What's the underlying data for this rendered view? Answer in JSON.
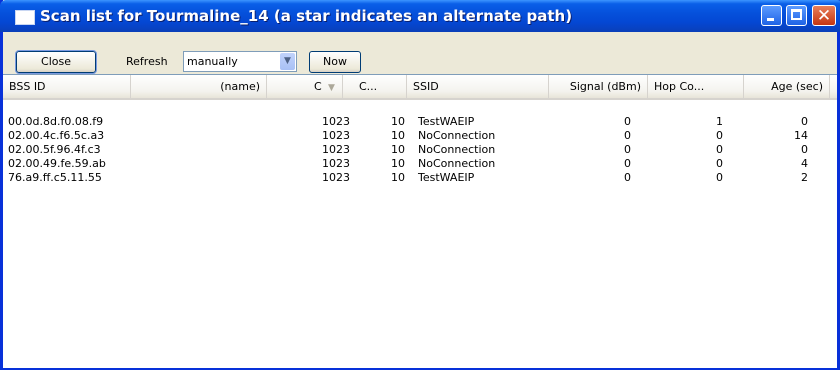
{
  "window": {
    "title": "Scan list for Tourmaline_14 (a star indicates an alternate path)",
    "close_glyph": "✕"
  },
  "toolbar": {
    "close_label": "Close",
    "refresh_label": "Refresh",
    "refresh_value": "manually",
    "now_label": "Now"
  },
  "columns": {
    "bssid": "BSS ID",
    "name": "(name)",
    "c1": "C",
    "c2": "C...",
    "ssid": "SSID",
    "signal": "Signal (dBm)",
    "hop": "Hop Co...",
    "age": "Age (sec)"
  },
  "rows": [
    {
      "bssid": "00.0d.8d.f0.08.f9",
      "name": "",
      "c1": "1023",
      "c2": "10",
      "ssid": "TestWAEIP",
      "signal": "0",
      "hop": "1",
      "age": "0"
    },
    {
      "bssid": "02.00.4c.f6.5c.a3",
      "name": "",
      "c1": "1023",
      "c2": "10",
      "ssid": "NoConnection",
      "signal": "0",
      "hop": "0",
      "age": "14"
    },
    {
      "bssid": "02.00.5f.96.4f.c3",
      "name": "",
      "c1": "1023",
      "c2": "10",
      "ssid": "NoConnection",
      "signal": "0",
      "hop": "0",
      "age": "0"
    },
    {
      "bssid": "02.00.49.fe.59.ab",
      "name": "",
      "c1": "1023",
      "c2": "10",
      "ssid": "NoConnection",
      "signal": "0",
      "hop": "0",
      "age": "4"
    },
    {
      "bssid": "76.a9.ff.c5.11.55",
      "name": "",
      "c1": "1023",
      "c2": "10",
      "ssid": "TestWAEIP",
      "signal": "0",
      "hop": "0",
      "age": "2"
    }
  ],
  "colors": {
    "title_bar": "#0551dc",
    "frame": "#0831d9",
    "face": "#ece9d8"
  }
}
